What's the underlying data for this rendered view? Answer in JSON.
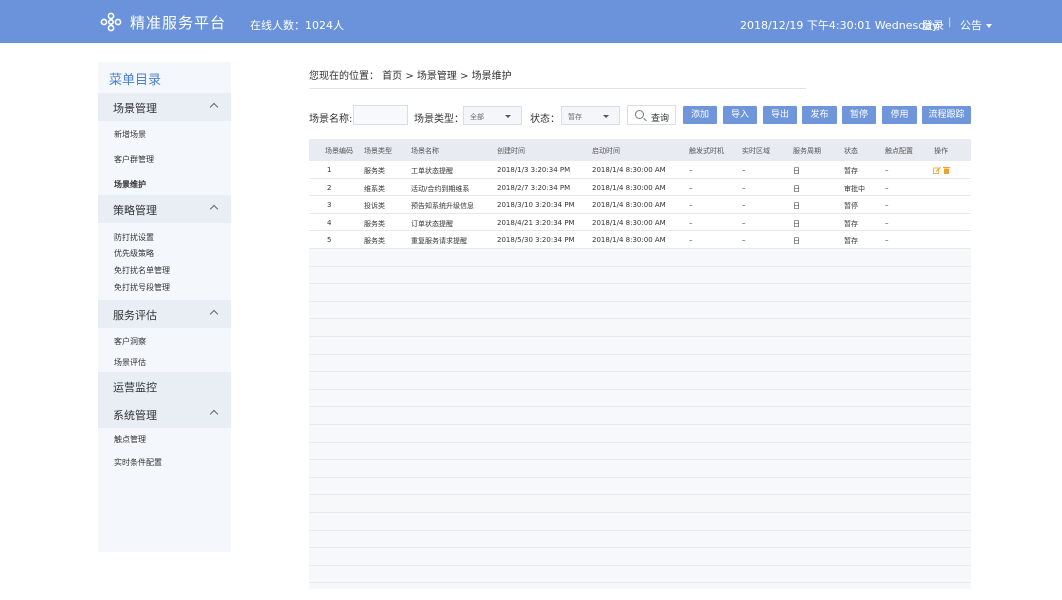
{
  "header": {
    "app_title": "精准服务平台",
    "online": "在线人数：1024人",
    "datetime": "2018/12/19 下午4:30:01 Wednesday",
    "login": "登录",
    "separator": "|",
    "notice": "公告",
    "color": "#6a93dc"
  },
  "sidebar": {
    "title": "菜单目录",
    "groups": [
      {
        "label": "场景管理",
        "items": [
          "新增场景",
          "客户群管理",
          "场景维护"
        ]
      },
      {
        "label": "策略管理",
        "items": [
          "防打扰设置",
          "优先级策略",
          "免打扰名单管理",
          "免打扰号段管理"
        ]
      },
      {
        "label": "服务评估",
        "items": [
          "客户洞察",
          "场景评估"
        ]
      },
      {
        "label": "运营监控",
        "items": []
      },
      {
        "label": "系统管理",
        "items": [
          "触点管理",
          "实时条件配置"
        ]
      }
    ],
    "active_item": "场景维护"
  },
  "breadcrumb": "您现在的位置：  首页 > 场景管理 > 场景维护",
  "filters": {
    "name_label": "场景名称:",
    "type_label": "场景类型：",
    "type_value": "全部",
    "status_label": "状态：",
    "status_value": "暂存",
    "query_label": "查询"
  },
  "buttons": [
    "添加",
    "导入",
    "导出",
    "发布",
    "暂停",
    "停用",
    "流程跟踪"
  ],
  "accent_color": "#6f95db",
  "table": {
    "columns": [
      "场景编码",
      "场景类型",
      "场景名称",
      "创建时间",
      "启动时间",
      "触发式时机",
      "实时区域",
      "服务周期",
      "状态",
      "触点配置",
      "操作"
    ],
    "rows": [
      [
        "1",
        "服务类",
        "工单状态提醒",
        "2018/1/3  3:20:34 PM",
        "2018/1/4  8:30:00 AM",
        "–",
        "–",
        "日",
        "暂存",
        "–"
      ],
      [
        "2",
        "维系类",
        "活动/合约到期维系",
        "2018/2/7  3:20:34 PM",
        "2018/1/4  8:30:00 AM",
        "–",
        "–",
        "日",
        "审批中",
        "–"
      ],
      [
        "3",
        "投诉类",
        "预告知系统升级信息",
        "2018/3/10  3:20:34 PM",
        "2018/1/4  8:30:00 AM",
        "–",
        "–",
        "日",
        "暂停",
        "–"
      ],
      [
        "4",
        "服务类",
        "订单状态提醒",
        "2018/4/21  3:20:34 PM",
        "2018/1/4  8:30:00 AM",
        "–",
        "–",
        "日",
        "暂存",
        "–"
      ],
      [
        "5",
        "服务类",
        "重复服务请求提醒",
        "2018/5/30  3:20:34 PM",
        "2018/1/4  8:30:00 AM",
        "–",
        "–",
        "日",
        "暂存",
        "–"
      ]
    ]
  }
}
